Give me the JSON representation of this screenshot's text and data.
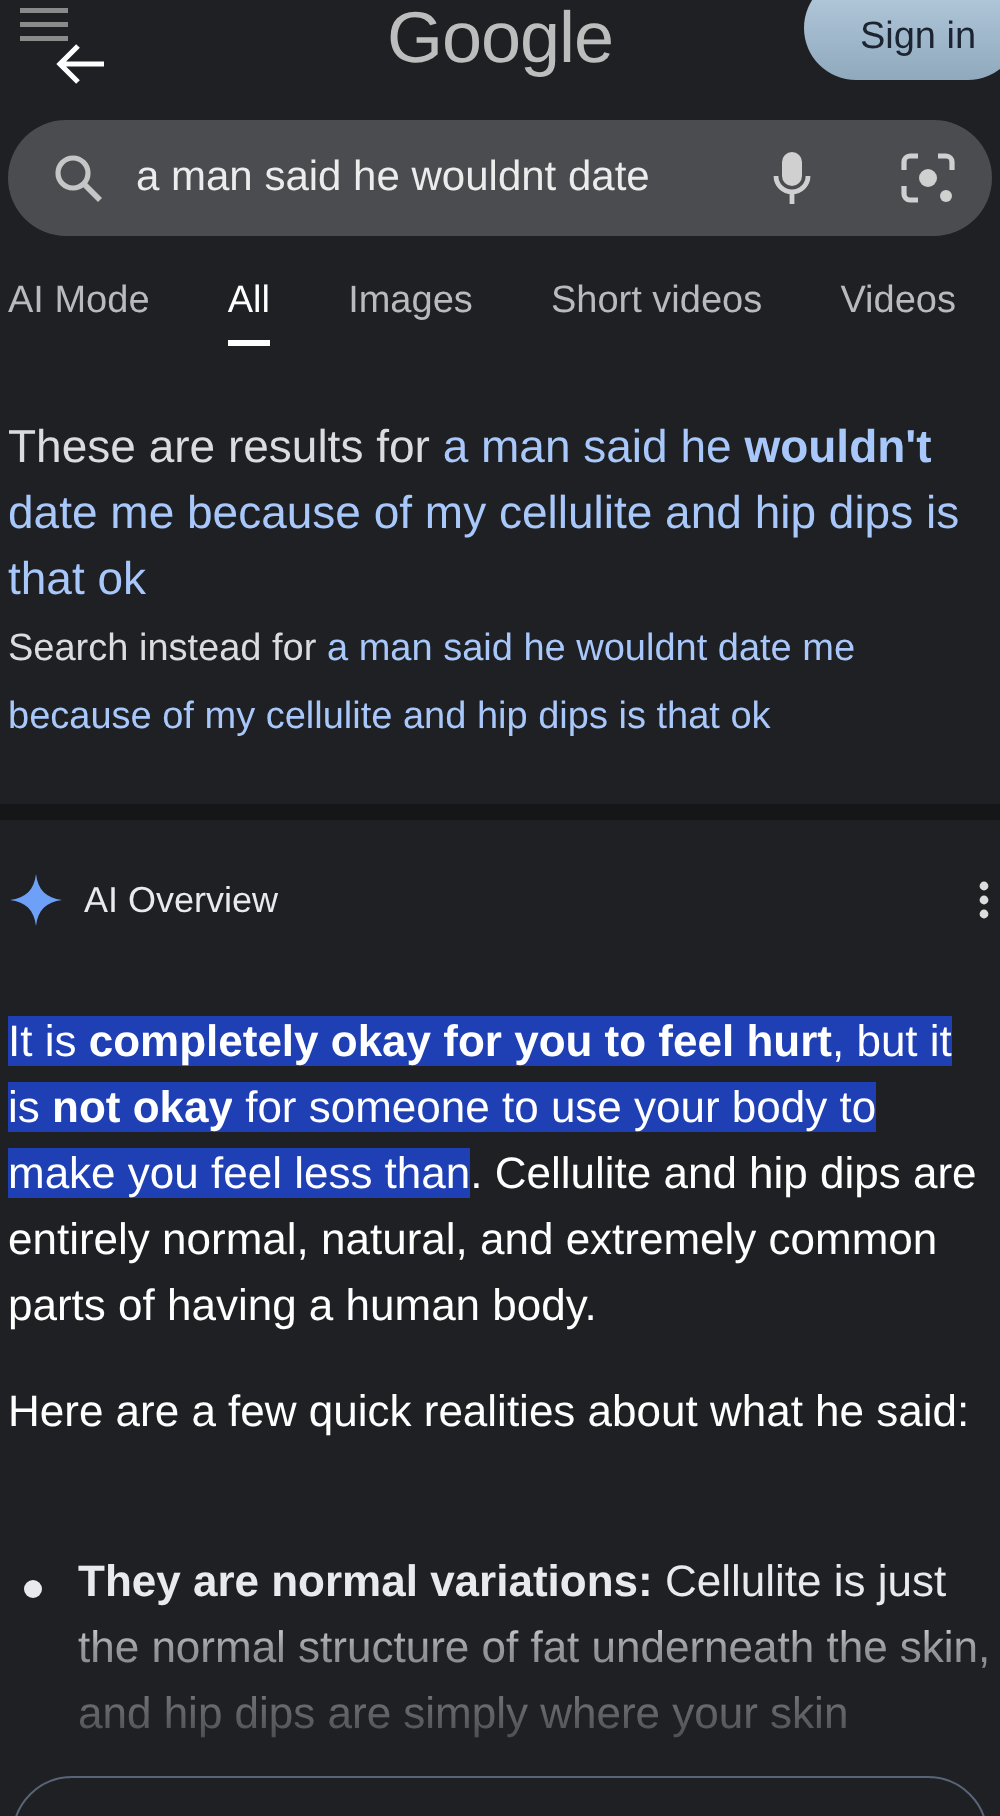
{
  "header": {
    "logo": "Google",
    "sign_in": "Sign in"
  },
  "search": {
    "value": "a man said he wouldnt date"
  },
  "tabs": [
    {
      "label": "AI Mode",
      "selected": false
    },
    {
      "label": "All",
      "selected": true
    },
    {
      "label": "Images",
      "selected": false
    },
    {
      "label": "Short videos",
      "selected": false
    },
    {
      "label": "Videos",
      "selected": false
    }
  ],
  "correction": {
    "prefix": "These are results for",
    "corrected_query": "a man said he **wouldn't** date me because of my cellulite and hip dips is that ok",
    "instead_prefix": "Search instead for",
    "original_query": "a man said he wouldnt date me because of my cellulite and hip dips is that ok"
  },
  "ai_overview": {
    "title": "AI Overview",
    "summary": [
      {
        "text": "It is ",
        "bold": false,
        "highlighted": true
      },
      {
        "text": "completely okay for you to feel hurt",
        "bold": true,
        "highlighted": true
      },
      {
        "text": ", but it is ",
        "bold": false,
        "highlighted": true
      },
      {
        "text": "not okay",
        "bold": true,
        "highlighted": true
      },
      {
        "text": " for someone to use your body to make you feel less than",
        "bold": false,
        "highlighted": true
      },
      {
        "text": ". Cellulite and hip dips are entirely normal, natural, and extremely common parts of having a human body.",
        "bold": false,
        "highlighted": false
      }
    ],
    "intro": "Here are a few quick realities about what he said:",
    "bullets": [
      {
        "heading": "They are normal variations:",
        "text": "Cellulite is just the normal structure of fat underneath the skin, and hip dips are simply where your skin"
      }
    ]
  }
}
